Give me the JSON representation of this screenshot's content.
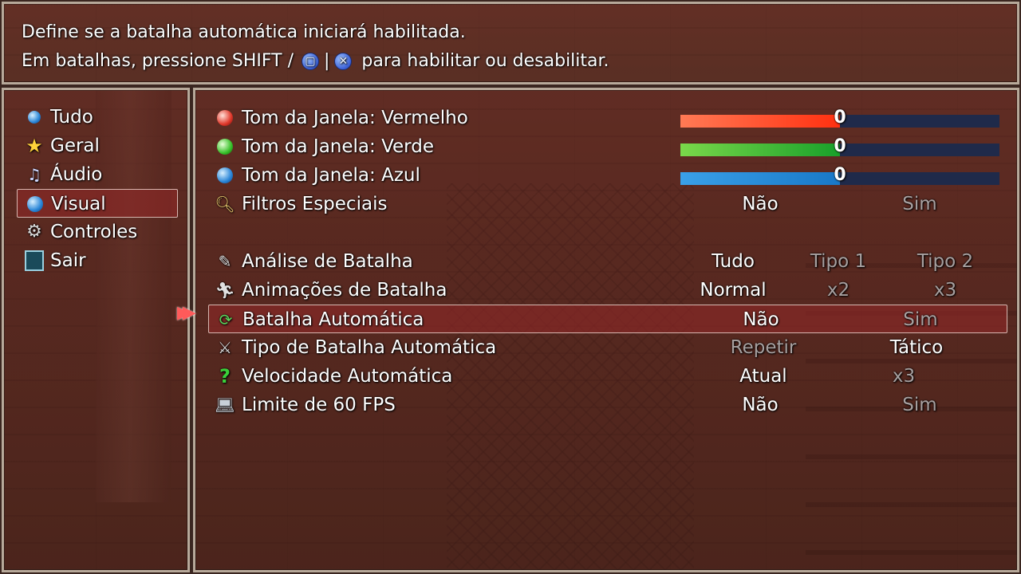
{
  "help": {
    "line1": "Define se a batalha automática iniciará habilitada.",
    "line2_prefix": "Em batalhas, pressione SHIFT /",
    "line2_sep": "|",
    "line2_suffix": "para habilitar ou desabilitar.",
    "glyph1": "▢",
    "glyph2": "✕"
  },
  "categories": [
    {
      "label": "Tudo",
      "icon": "blue-orb-icon"
    },
    {
      "label": "Geral",
      "icon": "star-icon"
    },
    {
      "label": "Áudio",
      "icon": "music-note-icon"
    },
    {
      "label": "Visual",
      "icon": "globe-icon",
      "selected": true
    },
    {
      "label": "Controles",
      "icon": "gear-icon"
    },
    {
      "label": "Sair",
      "icon": "exit-icon"
    }
  ],
  "options": [
    {
      "label": "Tom da Janela: Vermelho",
      "icon": "red-orb-icon",
      "type": "slider",
      "value": 0,
      "fill": 0.5,
      "color": "#ff3010"
    },
    {
      "label": "Tom da Janela: Verde",
      "icon": "green-orb-icon",
      "type": "slider",
      "value": 0,
      "fill": 0.5,
      "color": "#18a02a"
    },
    {
      "label": "Tom da Janela: Azul",
      "icon": "blue-orb-icon",
      "type": "slider",
      "value": 0,
      "fill": 0.5,
      "color": "#1878c8"
    },
    {
      "label": "Filtros Especiais",
      "icon": "magnifier-icon",
      "values": [
        "Não",
        "Sim"
      ],
      "selected": 0
    },
    {
      "label": "Análise de Batalha",
      "icon": "quill-icon",
      "values": [
        "Tudo",
        "Tipo 1",
        "Tipo 2"
      ],
      "selected": 0
    },
    {
      "label": "Animações de Batalha",
      "icon": "figure-icon",
      "values": [
        "Normal",
        "x2",
        "x3"
      ],
      "selected": 0
    },
    {
      "label": "Batalha Automática",
      "icon": "auto-cycle-icon",
      "values": [
        "Não",
        "Sim"
      ],
      "selected": 0,
      "highlighted": true
    },
    {
      "label": "Tipo de Batalha Automática",
      "icon": "sword-icon",
      "values": [
        "Repetir",
        "Tático"
      ],
      "selected": 1
    },
    {
      "label": "Velocidade Automática",
      "icon": "question-icon",
      "values": [
        "Atual",
        "x3"
      ],
      "selected": 0
    },
    {
      "label": "Limite de 60 FPS",
      "icon": "laptop-icon",
      "values": [
        "Não",
        "Sim"
      ],
      "selected": 0
    }
  ],
  "cursor": "▶▶"
}
